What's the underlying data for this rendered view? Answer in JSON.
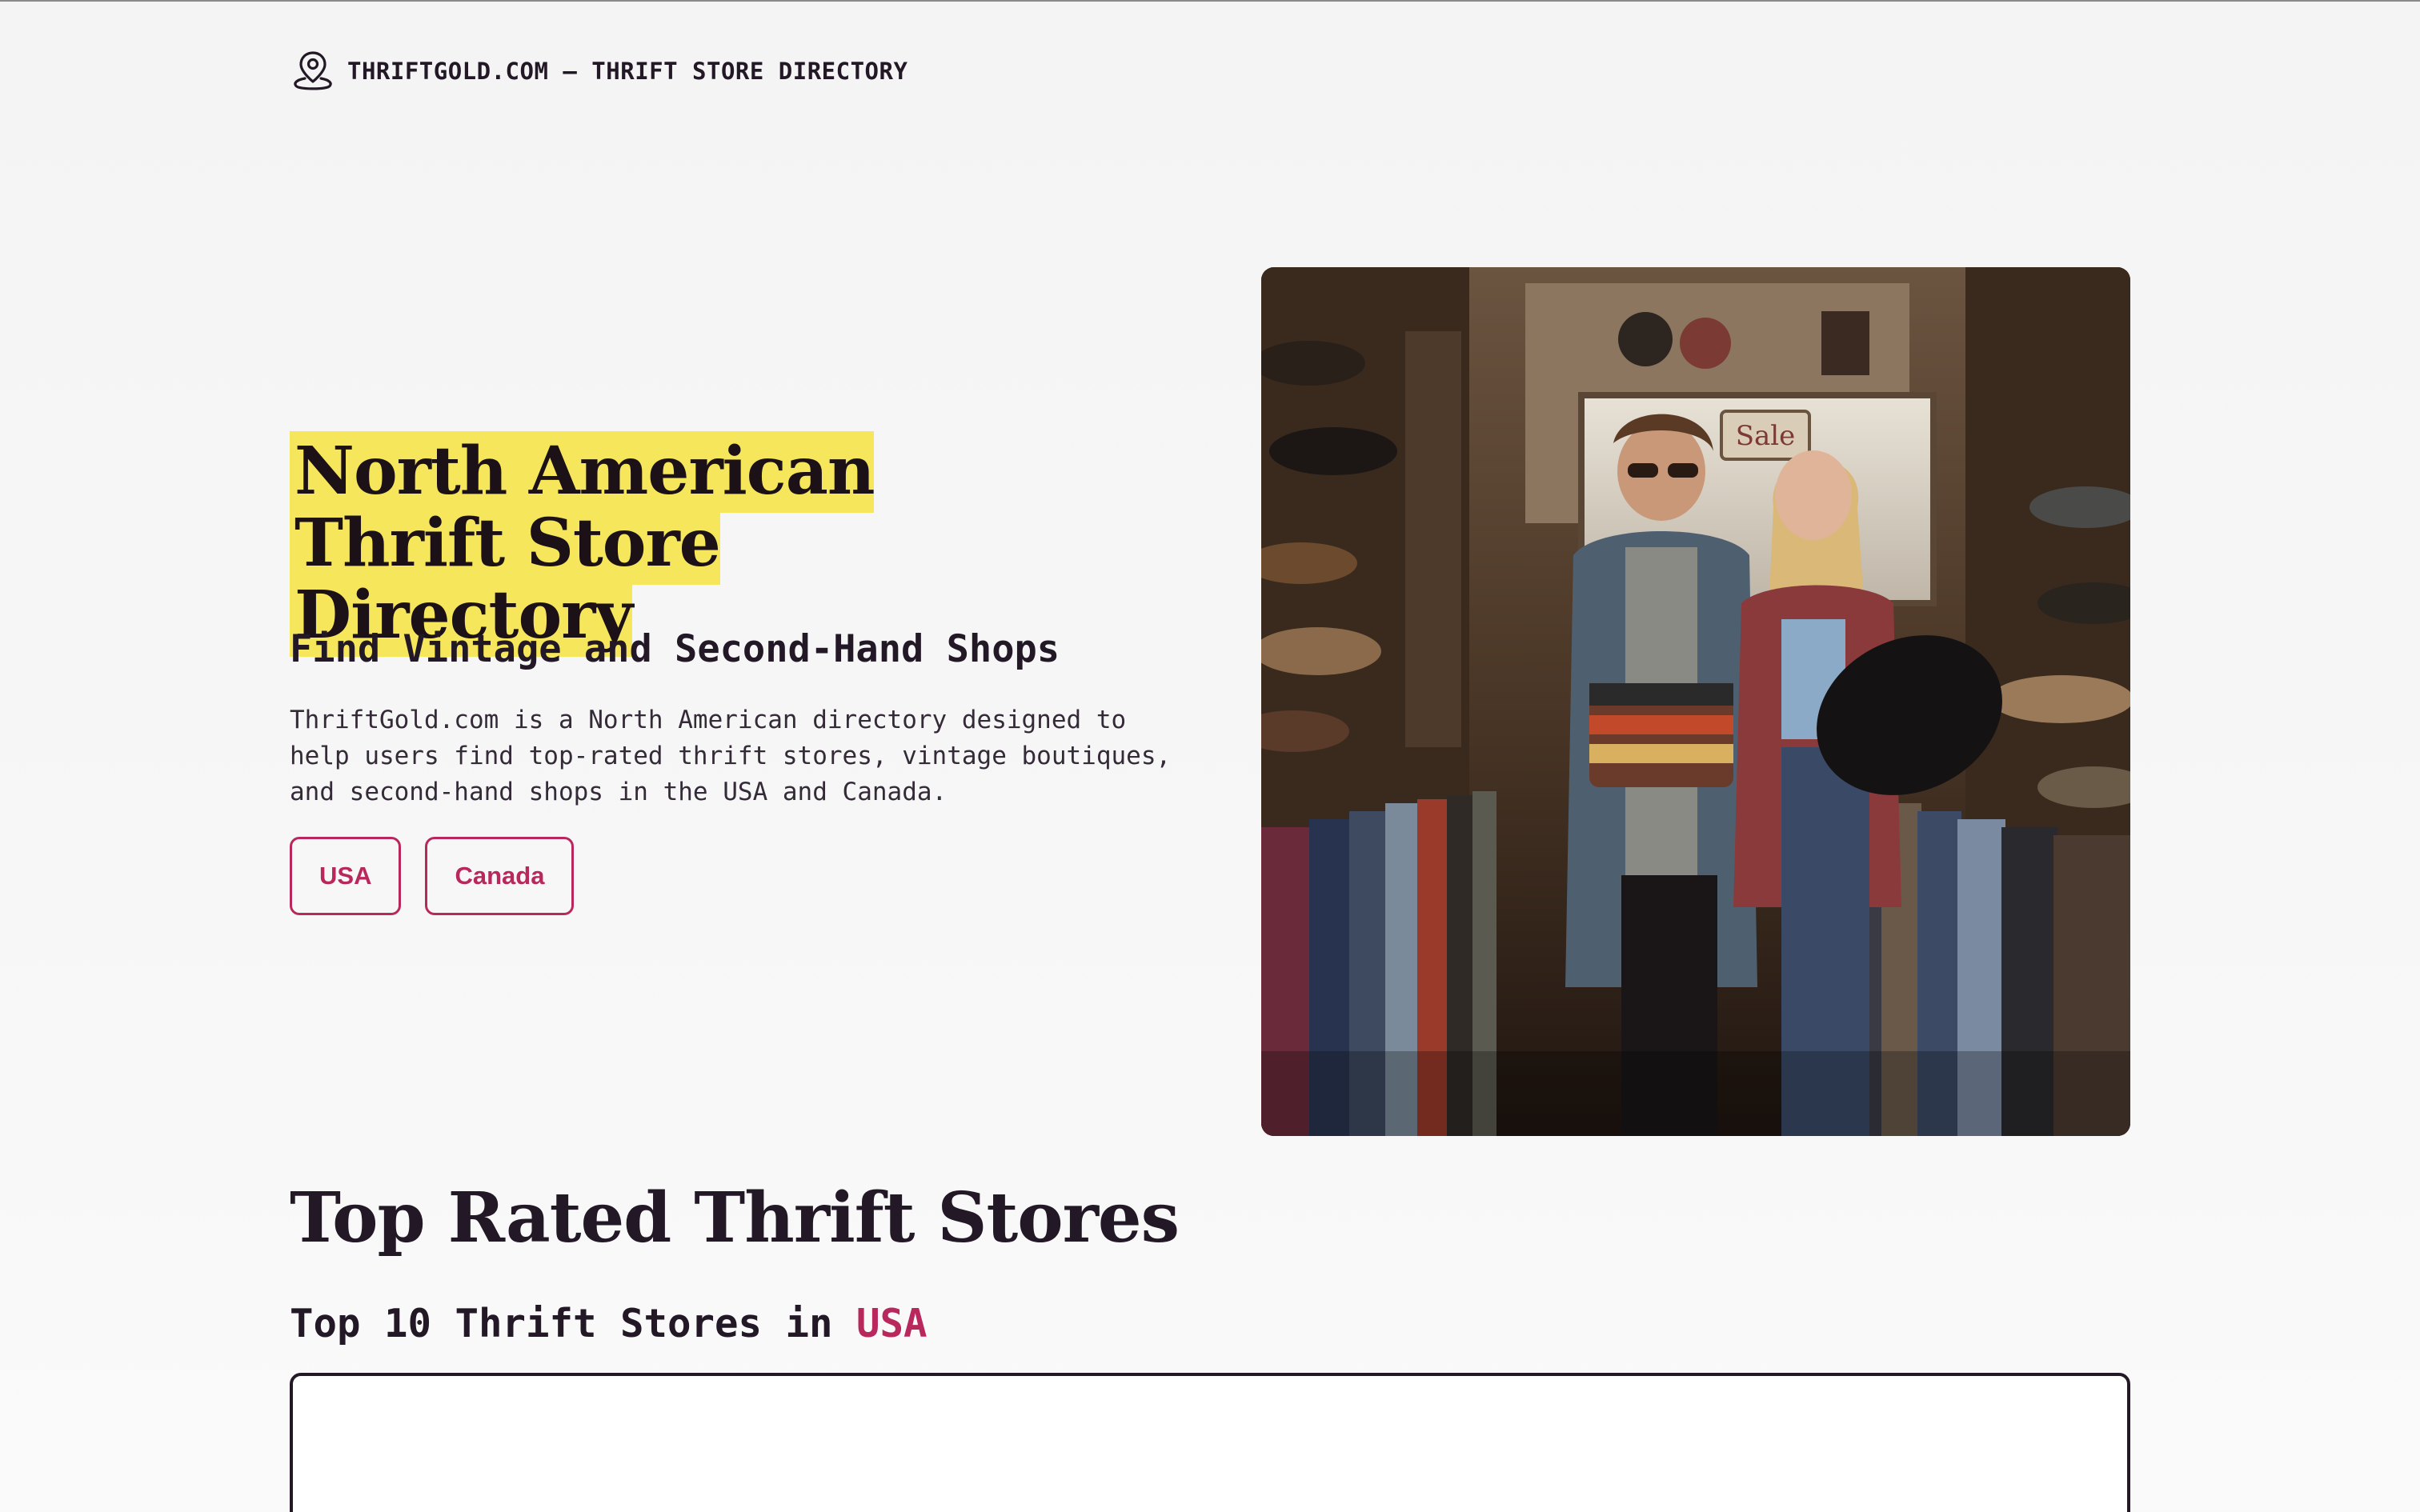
{
  "header": {
    "brand": "THRIFTGOLD.COM — THRIFT STORE DIRECTORY",
    "icon": "map-pin-icon"
  },
  "hero": {
    "title": "North American Thrift Store Directory",
    "subtitle": "Find Vintage and Second-Hand Shops",
    "description": "ThriftGold.com is a North American directory designed to help users find top-rated thrift stores, vintage boutiques, and second-hand shops in the USA and Canada.",
    "buttons": {
      "usa": "USA",
      "canada": "Canada"
    },
    "image_sign": "Sale"
  },
  "top_rated": {
    "title": "Top Rated Thrift Stores",
    "list_heading_prefix": "Top 10 Thrift Stores in ",
    "list_heading_country": "USA"
  },
  "colors": {
    "accent": "#b8285c",
    "highlight": "#f6e65c",
    "text": "#231826"
  }
}
